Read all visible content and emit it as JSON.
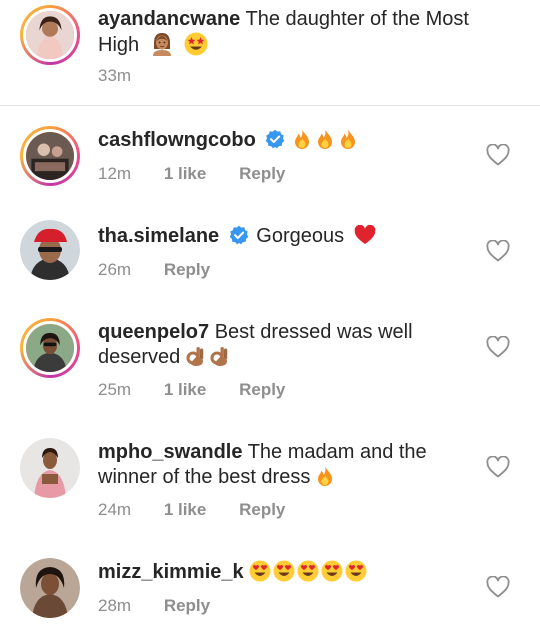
{
  "caption": {
    "username": "ayandancwane",
    "text": "The daughter of the Most High",
    "time": "33m",
    "emojis": [
      "woman-emoji",
      "star-struck-emoji"
    ]
  },
  "comments": [
    {
      "username": "cashflowngcobo",
      "verified": true,
      "text": "",
      "emojis": [
        "fire",
        "fire",
        "fire"
      ],
      "time": "12m",
      "likes": "1 like",
      "reply": "Reply"
    },
    {
      "username": "tha.simelane",
      "verified": true,
      "text": "Gorgeous",
      "emojis": [
        "red-heart"
      ],
      "time": "26m",
      "likes": "",
      "reply": "Reply"
    },
    {
      "username": "queenpelo7",
      "verified": false,
      "text": "Best dressed was well deserved",
      "emojis": [
        "ok-hand",
        "ok-hand"
      ],
      "time": "25m",
      "likes": "1 like",
      "reply": "Reply"
    },
    {
      "username": "mpho_swandle",
      "verified": false,
      "text": "The madam  and the winner of the best dress",
      "emojis": [
        "fire"
      ],
      "time": "24m",
      "likes": "1 like",
      "reply": "Reply"
    },
    {
      "username": "mizz_kimmie_k",
      "verified": false,
      "text": "",
      "emojis": [
        "heart-eyes",
        "heart-eyes",
        "heart-eyes",
        "heart-eyes",
        "heart-eyes"
      ],
      "time": "28m",
      "likes": "",
      "reply": "Reply"
    }
  ],
  "colors": {
    "verified_blue": "#3897f0",
    "meta_gray": "#8e8e8e",
    "text": "#262626",
    "divider": "#e3e3e3"
  }
}
